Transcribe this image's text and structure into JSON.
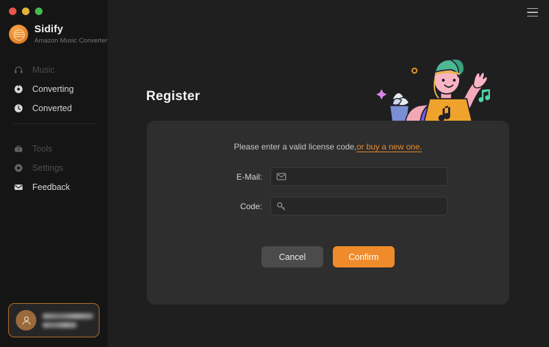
{
  "window": {
    "traffic_lights": [
      "close",
      "minimize",
      "maximize"
    ],
    "menu_icon": "hamburger-menu-icon"
  },
  "sidebar": {
    "brand": {
      "name": "Sidify",
      "subtitle": "Amazon Music Converter",
      "logo_icon": "sidify-logo-icon"
    },
    "items": [
      {
        "label": "Music",
        "icon": "headphones-icon",
        "state": "disabled"
      },
      {
        "label": "Converting",
        "icon": "convert-circle-icon",
        "state": "active"
      },
      {
        "label": "Converted",
        "icon": "clock-icon",
        "state": "active"
      },
      {
        "label": "Tools",
        "icon": "toolbox-icon",
        "state": "disabled"
      },
      {
        "label": "Settings",
        "icon": "gear-icon",
        "state": "disabled"
      },
      {
        "label": "Feedback",
        "icon": "envelope-icon",
        "state": "active"
      }
    ],
    "account": {
      "avatar_icon": "user-avatar-icon",
      "name": "",
      "detail": ""
    }
  },
  "main": {
    "title": "Register",
    "illustration": "person-waving-with-laptop-illustration",
    "card": {
      "hint_text": "Please enter a valid license code,",
      "hint_link": "or buy a new one.",
      "fields": [
        {
          "label": "E-Mail:",
          "icon": "envelope-icon",
          "value": "",
          "placeholder": ""
        },
        {
          "label": "Code:",
          "icon": "key-icon",
          "value": "",
          "placeholder": ""
        }
      ],
      "buttons": {
        "cancel": "Cancel",
        "confirm": "Confirm"
      }
    }
  },
  "colors": {
    "accent": "#ef8b2a",
    "link": "#e98a2b",
    "sidebar_bg": "#151515",
    "main_bg": "#1f1f1f",
    "card_bg": "#2e2e2e",
    "account_border": "#b8702a"
  }
}
